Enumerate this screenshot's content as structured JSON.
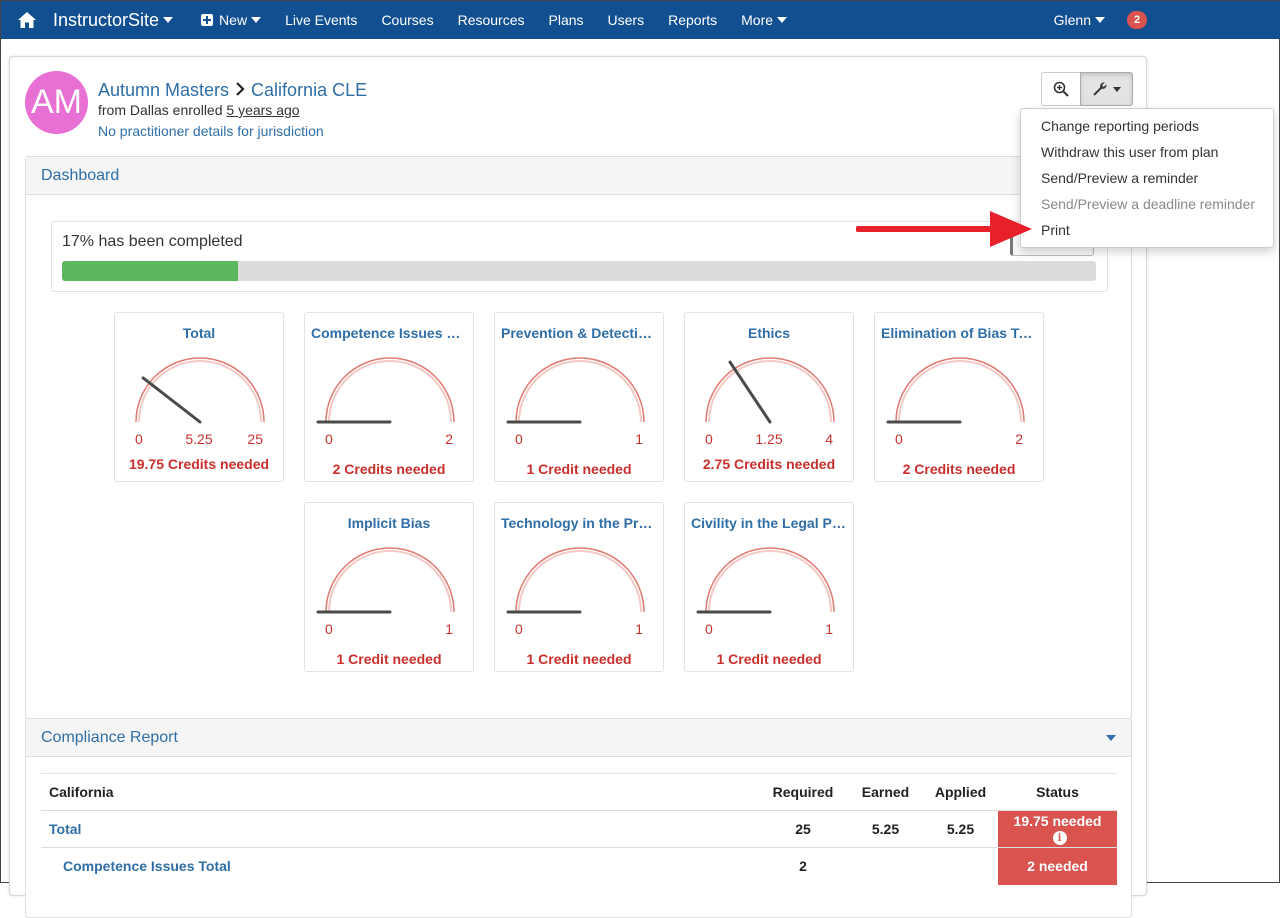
{
  "nav": {
    "brand": "InstructorSite",
    "new_label": "New",
    "items": [
      "Live Events",
      "Courses",
      "Resources",
      "Plans",
      "Users",
      "Reports"
    ],
    "more_label": "More",
    "user_label": "Glenn",
    "notification_count": "2"
  },
  "profile": {
    "initials": "AM",
    "name": "Autumn Masters",
    "plan": "California CLE",
    "enroll_prefix": "from Dallas enrolled",
    "enroll_when": "5 years ago",
    "jurisdiction_note": "No practitioner details for jurisdiction"
  },
  "menu": {
    "items": [
      {
        "label": "Change reporting periods",
        "disabled": false
      },
      {
        "label": "Withdraw this user from plan",
        "disabled": false
      },
      {
        "label": "Send/Preview a reminder",
        "disabled": false
      },
      {
        "label": "Send/Preview a deadline reminder",
        "disabled": true
      },
      {
        "label": "Print",
        "disabled": false
      }
    ]
  },
  "dashboard": {
    "title": "Dashboard",
    "progress_text": "17% has been completed",
    "progress_percent": 17,
    "gauges": [
      {
        "title": "Total",
        "min": "0",
        "max": "25",
        "value": "5.25",
        "needed": "19.75 Credits needed"
      },
      {
        "title": "Competence Issues Total",
        "min": "0",
        "max": "2",
        "value": "",
        "needed": "2 Credits needed"
      },
      {
        "title": "Prevention & Detection Total",
        "min": "0",
        "max": "1",
        "value": "",
        "needed": "1 Credit needed"
      },
      {
        "title": "Ethics",
        "min": "0",
        "max": "4",
        "value": "1.25",
        "needed": "2.75 Credits needed"
      },
      {
        "title": "Elimination of Bias Total",
        "min": "0",
        "max": "2",
        "value": "",
        "needed": "2 Credits needed"
      },
      {
        "title": "Implicit Bias",
        "min": "0",
        "max": "1",
        "value": "",
        "needed": "1 Credit needed"
      },
      {
        "title": "Technology in the Practice of Law",
        "min": "0",
        "max": "1",
        "value": "",
        "needed": "1 Credit needed"
      },
      {
        "title": "Civility in the Legal Profession",
        "min": "0",
        "max": "1",
        "value": "",
        "needed": "1 Credit needed"
      }
    ]
  },
  "compliance": {
    "title": "Compliance Report",
    "headers": [
      "California",
      "Required",
      "Earned",
      "Applied",
      "Status"
    ],
    "rows": [
      {
        "name": "Total",
        "required": "25",
        "earned": "5.25",
        "applied": "5.25",
        "status": "19.75 needed"
      },
      {
        "name": "Competence Issues Total",
        "required": "2",
        "earned": "",
        "applied": "",
        "status": "2 needed"
      }
    ]
  },
  "colors": {
    "nav_bg": "#114f90",
    "link": "#2f6ea7",
    "progress_fill": "#5cb85c",
    "danger": "#d9534f",
    "avatar": "#e86fd4",
    "arrow": "#e8202a"
  },
  "icons": [
    "home-icon",
    "plus-icon",
    "zoom-icon",
    "wrench-icon",
    "chevron-right-icon",
    "caret-down-icon",
    "info-icon",
    "arrow-annotation"
  ]
}
